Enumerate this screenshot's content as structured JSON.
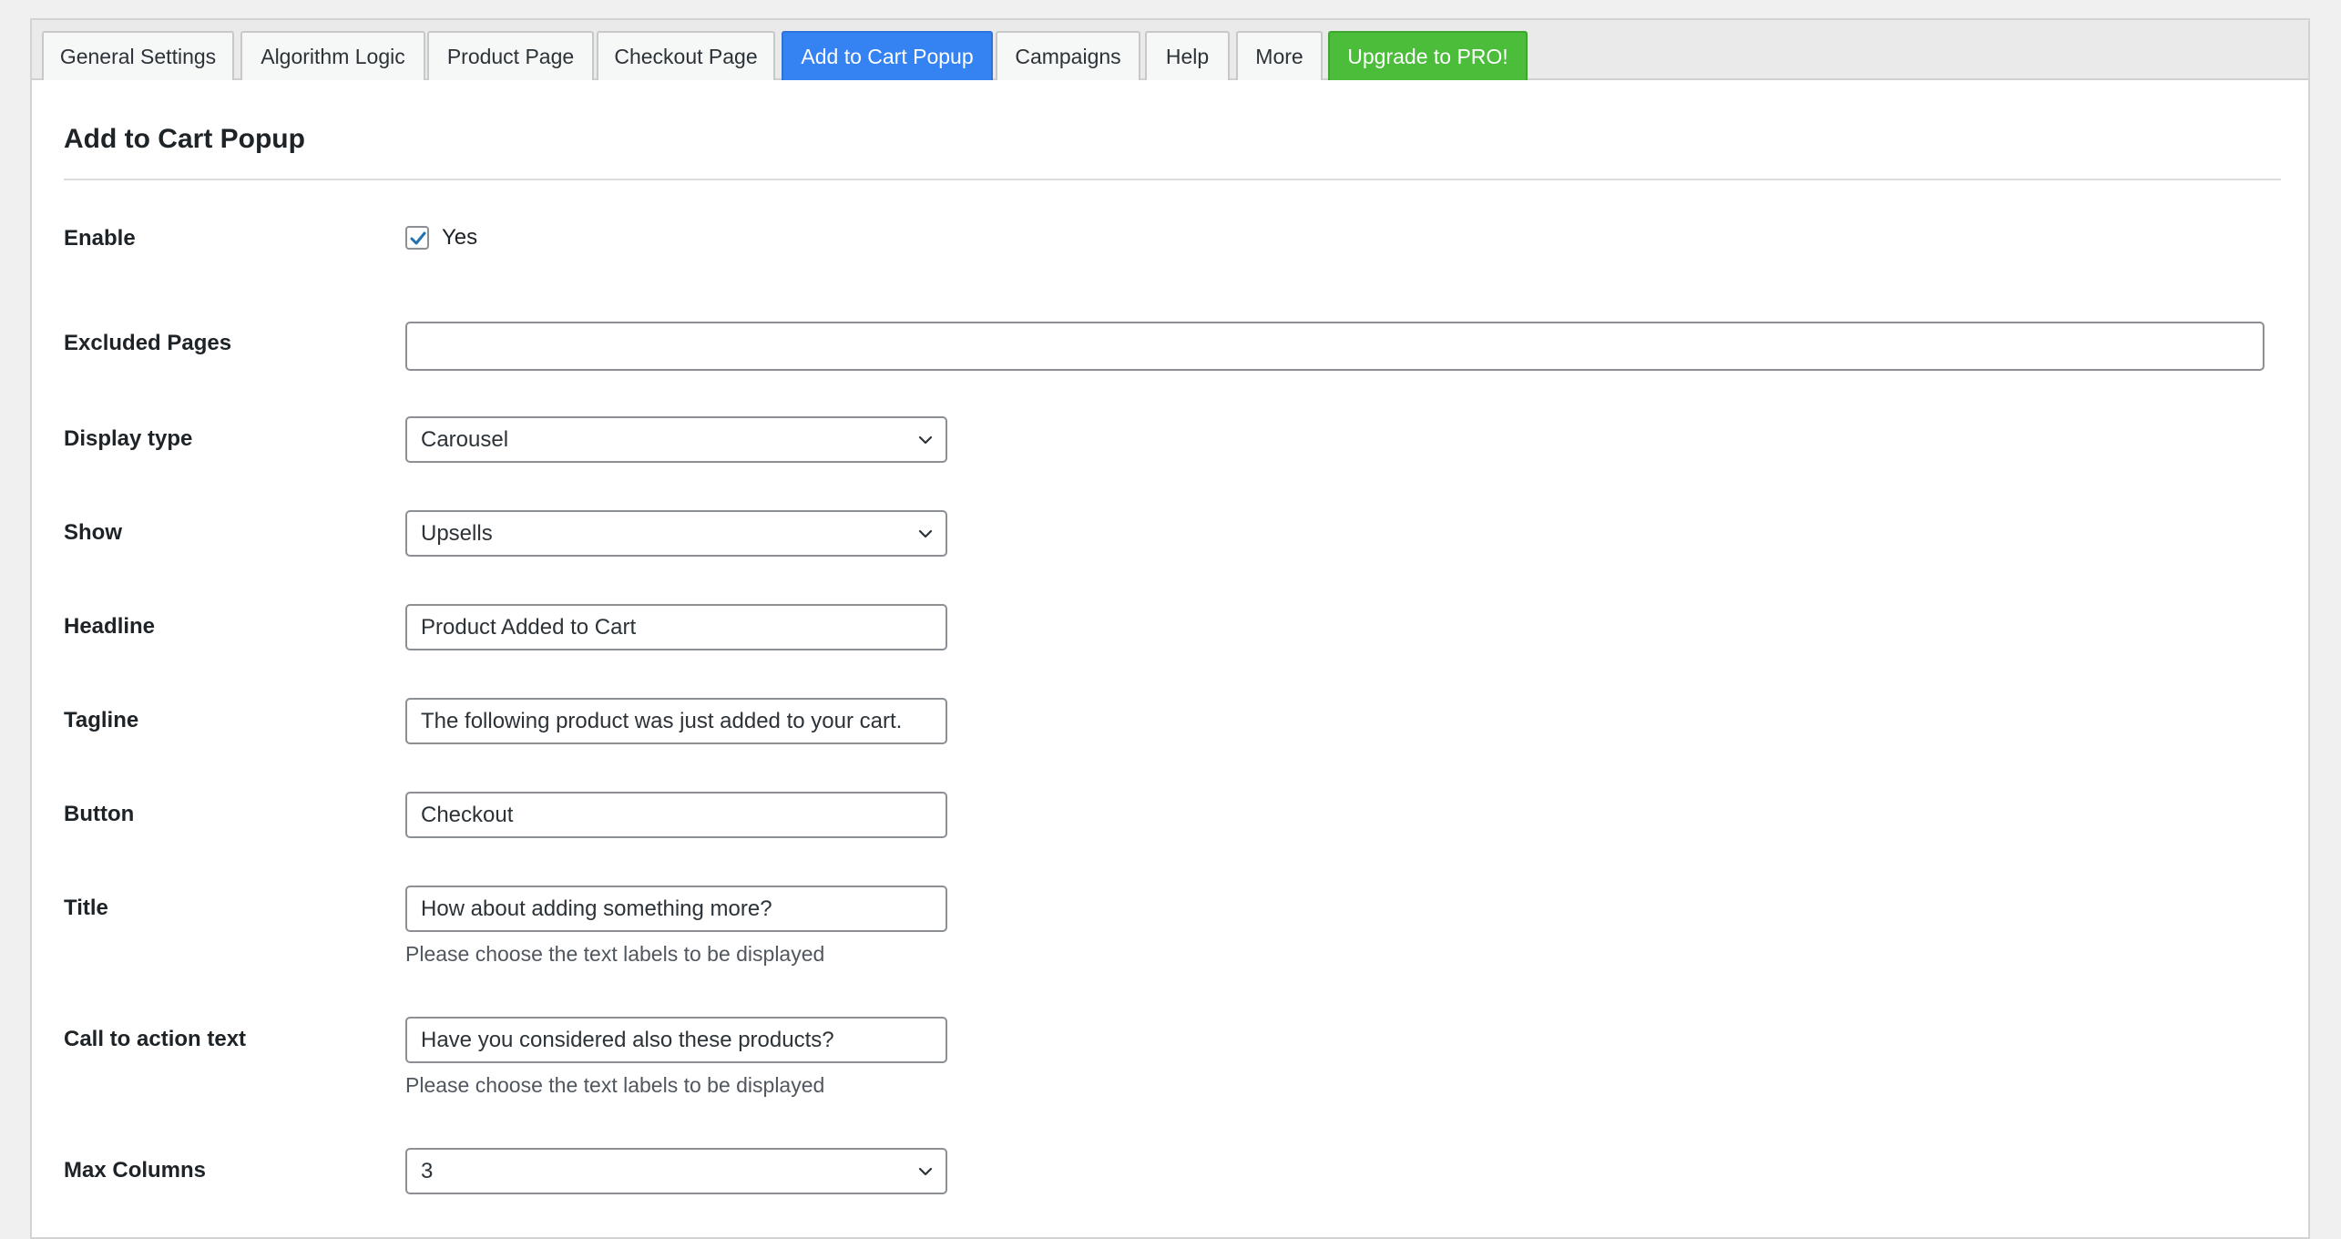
{
  "tabs": [
    {
      "label": "General Settings"
    },
    {
      "label": "Algorithm Logic"
    },
    {
      "label": "Product Page"
    },
    {
      "label": "Checkout Page"
    },
    {
      "label": "Add to Cart Popup"
    },
    {
      "label": "Campaigns"
    },
    {
      "label": "Help"
    },
    {
      "label": "More"
    },
    {
      "label": "Upgrade to PRO!"
    }
  ],
  "active_tab": "Add to Cart Popup",
  "colors": {
    "active_tab": "#3582f3",
    "pro_tab": "#4bbd3a",
    "checkbox_check": "#2271b1"
  },
  "section_title": "Add to Cart Popup",
  "settings": {
    "enable": {
      "label": "Enable",
      "checked": true,
      "option_label": "Yes"
    },
    "excluded_pages": {
      "label": "Excluded Pages",
      "value": ""
    },
    "display_type": {
      "label": "Display type",
      "value": "Carousel"
    },
    "show": {
      "label": "Show",
      "value": "Upsells"
    },
    "headline": {
      "label": "Headline",
      "value": "Product Added to Cart"
    },
    "tagline": {
      "label": "Tagline",
      "value": "The following product was just added to your cart."
    },
    "button": {
      "label": "Button",
      "value": "Checkout"
    },
    "title": {
      "label": "Title",
      "value": "How about adding something more?",
      "help": "Please choose the text labels to be displayed"
    },
    "cta_text": {
      "label": "Call to action text",
      "value": "Have you considered also these products?",
      "help": "Please choose the text labels to be displayed"
    },
    "max_columns": {
      "label": "Max Columns",
      "value": "3"
    }
  },
  "icons": {
    "checkbox": "checkmark-icon",
    "select": "chevron-down-icon"
  }
}
